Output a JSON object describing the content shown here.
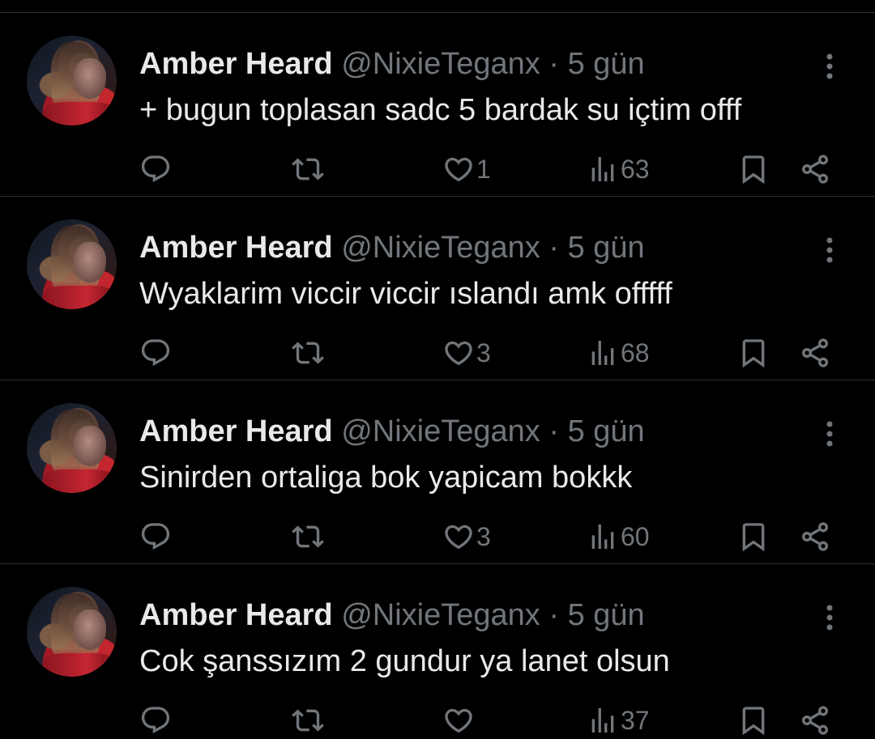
{
  "colors": {
    "background": "#000000",
    "text_primary": "#e7e9ea",
    "text_secondary": "#71767b",
    "divider": "#2f3336"
  },
  "icons": {
    "reply": "reply-icon",
    "retweet": "retweet-icon",
    "like": "heart-icon",
    "views": "views-bar-chart-icon",
    "bookmark": "bookmark-icon",
    "share": "share-icon",
    "more": "more-dots-icon"
  },
  "tweets": [
    {
      "author": "Amber Heard",
      "handle": "@NixieTeganx",
      "separator": "·",
      "time": "5 gün",
      "text": "+ bugun toplasan sadc 5 bardak su içtim offf",
      "likes": "1",
      "views": "63"
    },
    {
      "author": "Amber Heard",
      "handle": "@NixieTeganx",
      "separator": "·",
      "time": "5 gün",
      "text": "Wyaklarim viccir viccir ıslandı amk offfff",
      "likes": "3",
      "views": "68"
    },
    {
      "author": "Amber Heard",
      "handle": "@NixieTeganx",
      "separator": "·",
      "time": "5 gün",
      "text": "Sinirden ortaliga bok yapicam bokkk",
      "likes": "3",
      "views": "60"
    },
    {
      "author": "Amber Heard",
      "handle": "@NixieTeganx",
      "separator": "·",
      "time": "5 gün",
      "text": "Cok şanssızım 2 gundur ya lanet olsun",
      "likes": "",
      "views": "37"
    }
  ]
}
